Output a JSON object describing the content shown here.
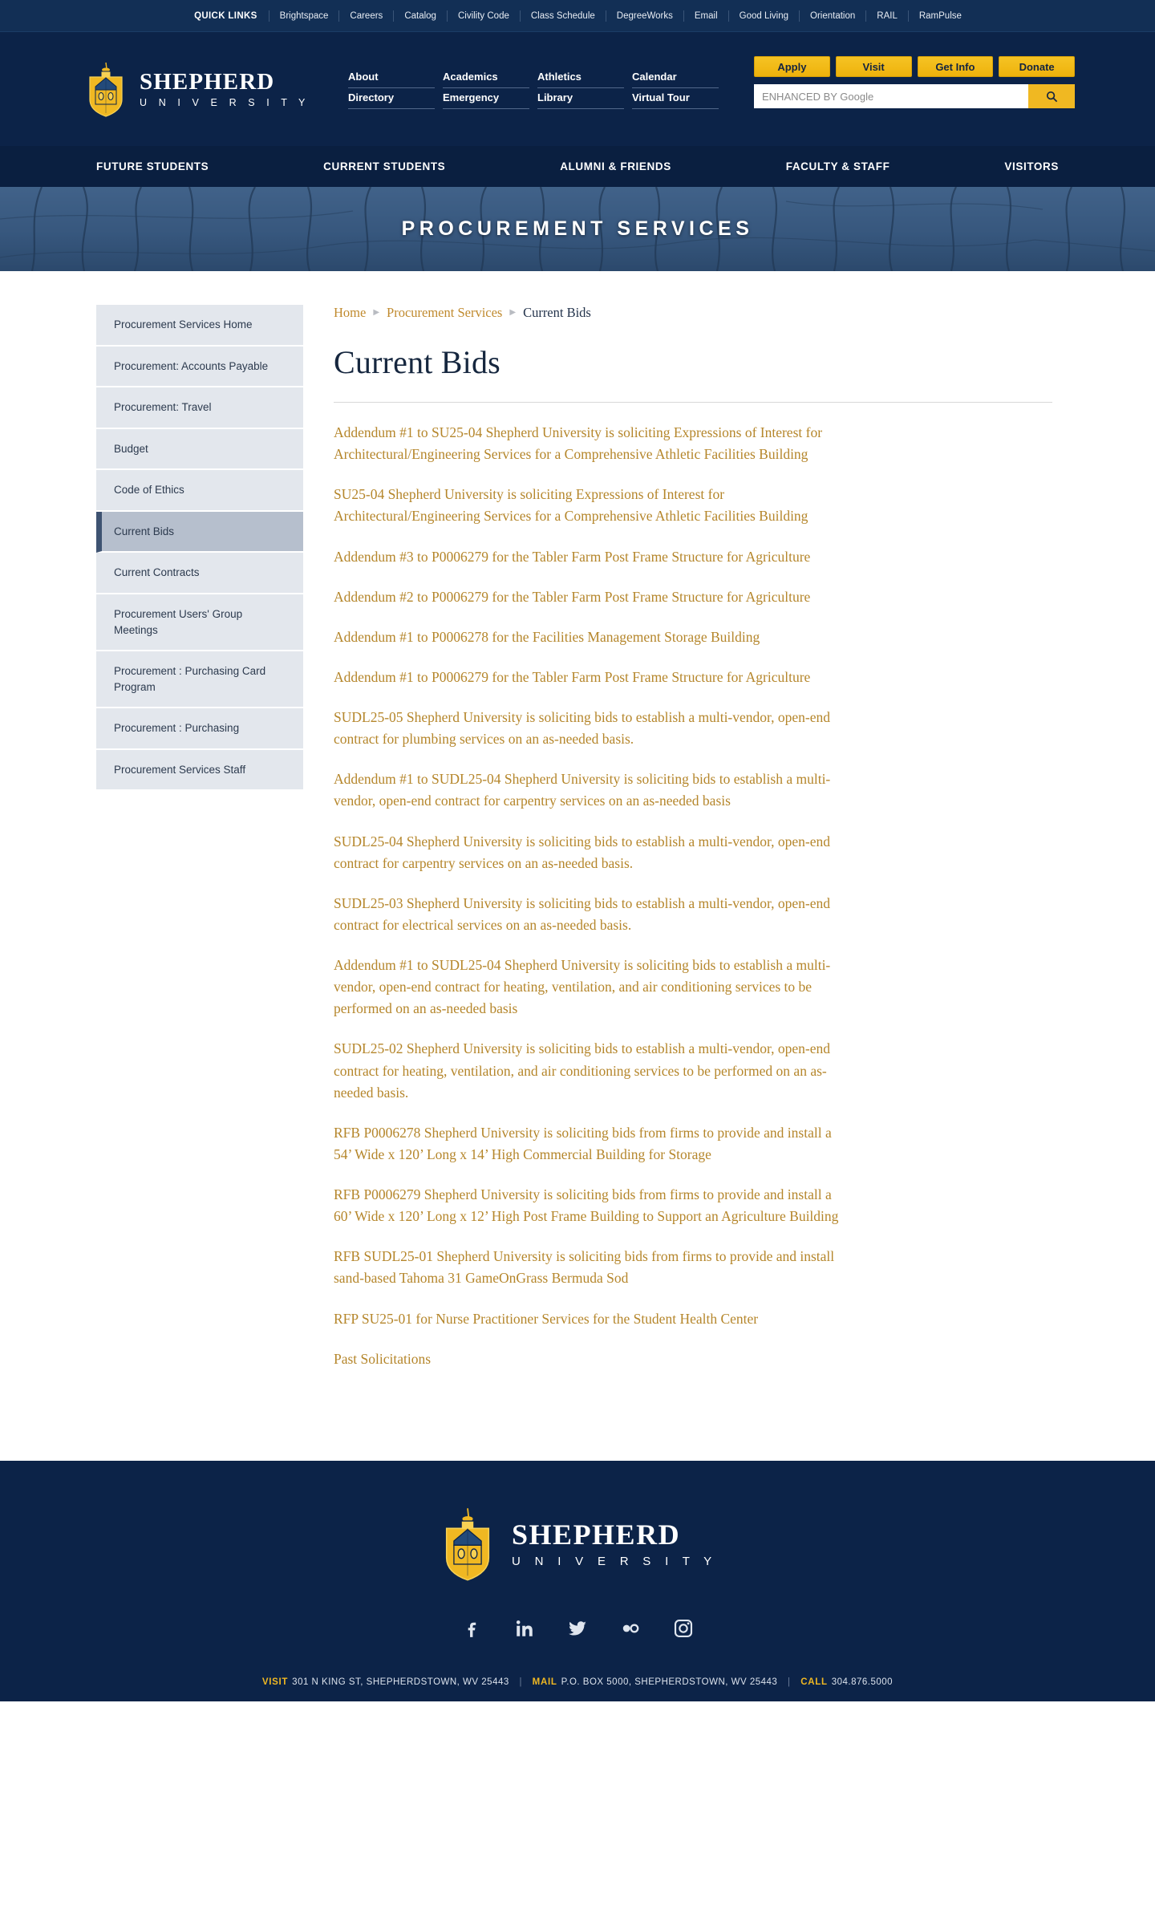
{
  "quicklinks": {
    "label": "QUICK LINKS",
    "items": [
      "Brightspace",
      "Careers",
      "Catalog",
      "Civility Code",
      "Class Schedule",
      "DegreeWorks",
      "Email",
      "Good Living",
      "Orientation",
      "RAIL",
      "RamPulse"
    ]
  },
  "brand": {
    "name": "SHEPHERD",
    "sub": "U N I V E R S I T Y",
    "crest_alt": "shepherd-crest-logo"
  },
  "util_nav": [
    "About",
    "Academics",
    "Athletics",
    "Calendar",
    "Directory",
    "Emergency",
    "Library",
    "Virtual Tour"
  ],
  "actions": {
    "apply": "Apply",
    "visit": "Visit",
    "get_info": "Get Info",
    "donate": "Donate"
  },
  "search": {
    "placeholder": "ENHANCED BY Google",
    "value": "",
    "button_icon": "search-icon"
  },
  "audience_nav": [
    "FUTURE STUDENTS",
    "CURRENT STUDENTS",
    "ALUMNI & FRIENDS",
    "FACULTY & STAFF",
    "VISITORS"
  ],
  "hero": {
    "title": "PROCUREMENT SERVICES"
  },
  "sidebar": {
    "items": [
      {
        "label": "Procurement Services Home",
        "active": false
      },
      {
        "label": "Procurement: Accounts Payable",
        "active": false
      },
      {
        "label": "Procurement: Travel",
        "active": false
      },
      {
        "label": "Budget",
        "active": false
      },
      {
        "label": "Code of Ethics",
        "active": false
      },
      {
        "label": "Current Bids",
        "active": true
      },
      {
        "label": "Current Contracts",
        "active": false
      },
      {
        "label": "Procurement Users' Group Meetings",
        "active": false
      },
      {
        "label": "Procurement : Purchasing Card Program",
        "active": false
      },
      {
        "label": "Procurement : Purchasing",
        "active": false
      },
      {
        "label": "Procurement Services Staff",
        "active": false
      }
    ]
  },
  "breadcrumb": {
    "home": "Home",
    "parent": "Procurement Services",
    "current": "Current Bids"
  },
  "main": {
    "title": "Current Bids",
    "bids": [
      "Addendum #1 to SU25-04 Shepherd University is soliciting Expressions of Interest for Architectural/Engineering Services for a Comprehensive Athletic Facilities Building",
      "SU25-04 Shepherd University is soliciting Expressions of Interest for Architectural/Engineering Services for a Comprehensive Athletic Facilities Building",
      "Addendum #3 to P0006279 for the Tabler Farm Post Frame Structure for Agriculture",
      "Addendum #2 to P0006279 for the Tabler Farm Post Frame Structure for Agriculture",
      "Addendum #1 to P0006278 for the Facilities Management Storage Building",
      "Addendum #1 to P0006279 for the Tabler Farm Post Frame Structure for Agriculture",
      "SUDL25-05 Shepherd University is soliciting bids to establish a multi-vendor, open-end contract for plumbing services on an as-needed basis.",
      "Addendum #1 to SUDL25-04 Shepherd University is soliciting bids to establish a multi-vendor, open-end contract for carpentry services on an as-needed basis",
      "SUDL25-04 Shepherd University is soliciting bids to establish a multi-vendor, open-end contract for carpentry services on an as-needed basis.",
      "SUDL25-03 Shepherd University is soliciting bids to establish a multi-vendor, open-end contract for electrical services on an as-needed basis.",
      "Addendum #1 to SUDL25-04 Shepherd University is soliciting bids to establish a multi-vendor, open-end contract for heating, ventilation, and air conditioning services to be performed on an as-needed basis",
      "SUDL25-02 Shepherd University is soliciting bids to establish a multi-vendor, open-end contract for heating, ventilation, and air conditioning services to be performed on an as-needed basis.",
      "RFB P0006278 Shepherd University is soliciting bids from firms to provide and install a 54’ Wide x 120’ Long x 14’ High Commercial Building for Storage",
      "RFB P0006279 Shepherd University is soliciting bids from firms to provide and install a 60’ Wide x 120’ Long x 12’ High Post Frame Building to Support an Agriculture Building",
      "RFB SUDL25-01 Shepherd University is soliciting bids from firms to provide and install sand-based Tahoma 31 GameOnGrass Bermuda Sod",
      "RFP SU25-01 for Nurse Practitioner Services for the Student Health Center",
      "Past Solicitations"
    ]
  },
  "footer": {
    "brand_name": "SHEPHERD",
    "brand_sub": "U N I V E R S I T Y",
    "social": [
      "facebook-icon",
      "linkedin-icon",
      "twitter-icon",
      "flickr-icon",
      "instagram-icon"
    ],
    "contact": {
      "visit_label": "VISIT",
      "visit_value": "301 N KING ST, SHEPHERDSTOWN, WV 25443",
      "mail_label": "MAIL",
      "mail_value": "P.O. BOX 5000, SHEPHERDSTOWN, WV 25443",
      "call_label": "CALL",
      "call_value": "304.876.5000"
    }
  },
  "colors": {
    "navy": "#0c2348",
    "navy_dark": "#0a1f40",
    "gold": "#f0b822",
    "link_gold": "#b5862b",
    "sidebar_bg": "#e3e7ed",
    "sidebar_active": "#b6bfcd"
  }
}
